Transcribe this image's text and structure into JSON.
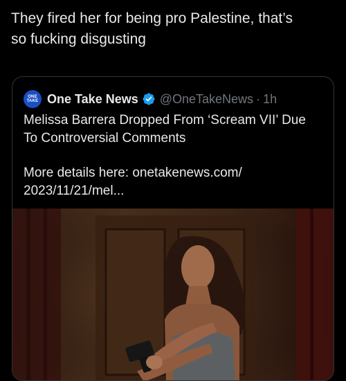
{
  "tweet": {
    "text": "They fired her for being pro Palestine, that’s\nso fucking disgusting"
  },
  "quote": {
    "avatar_lines": [
      "ONE",
      "TAKE"
    ],
    "display_name": "One Take News",
    "handle": "@OneTakeNews",
    "separator": "·",
    "time": "1h",
    "text_line1": "Melissa Barrera Dropped From ‘Scream VII’ Due",
    "text_line2": "To Controversial Comments",
    "text_line3": "More details here: onetakenews.com/",
    "text_line4": "2023/11/21/mel..."
  },
  "colors": {
    "background": "#000000",
    "text": "#e7e9ea",
    "secondary": "#71767b",
    "border": "#2f3336",
    "verified": "#1d9bf0"
  },
  "icons": {
    "verified": "verified-badge-icon",
    "avatar": "one-take-news-logo"
  }
}
